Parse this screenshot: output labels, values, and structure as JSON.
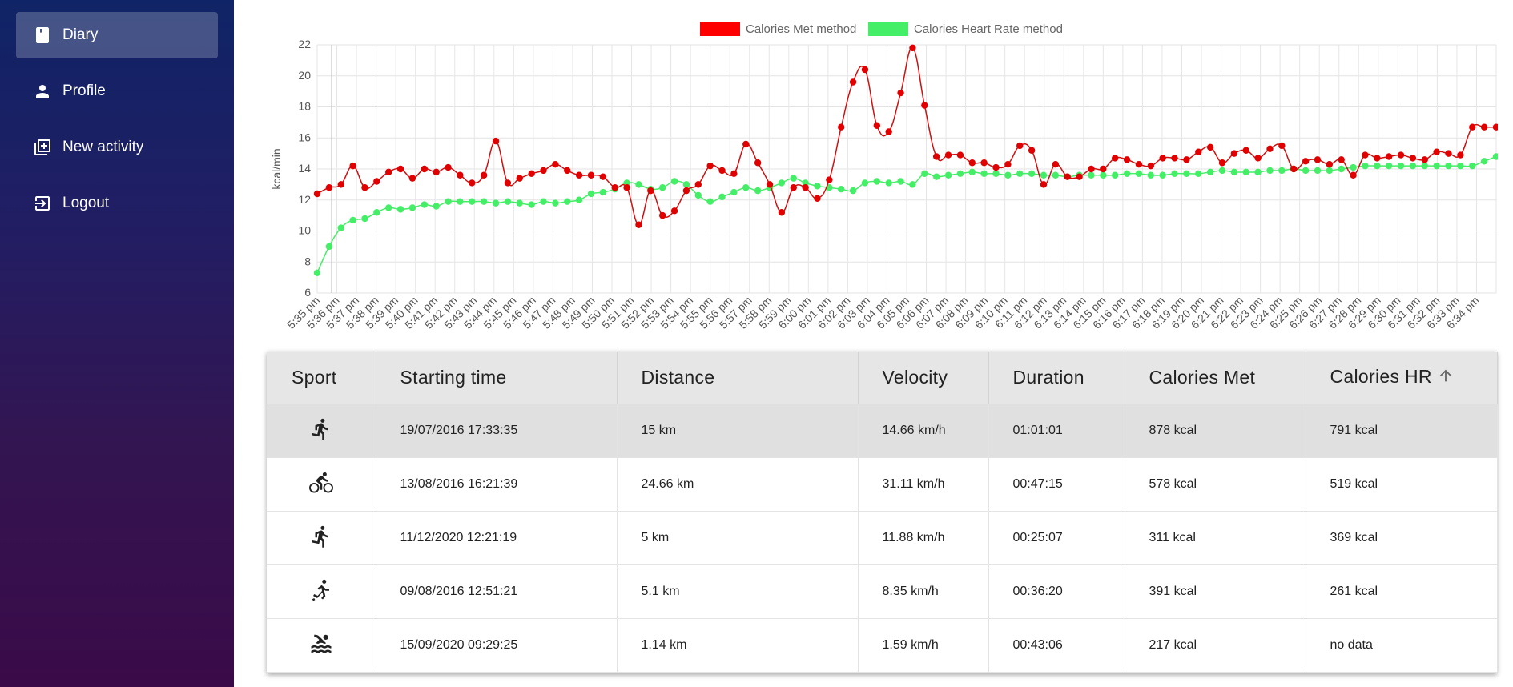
{
  "sidebar": {
    "items": [
      {
        "label": "Diary",
        "icon": "book-icon",
        "active": true
      },
      {
        "label": "Profile",
        "icon": "person-icon",
        "active": false
      },
      {
        "label": "New activity",
        "icon": "add-box-icon",
        "active": false
      },
      {
        "label": "Logout",
        "icon": "logout-icon",
        "active": false
      }
    ]
  },
  "chart_data": {
    "type": "line",
    "ylabel": "kcal/min",
    "ylim": [
      6,
      22
    ],
    "yticks": [
      6,
      8,
      10,
      12,
      14,
      16,
      18,
      20,
      22
    ],
    "grid": true,
    "legend_position": "top",
    "x_labels": [
      "5:35 pm",
      "5:36 pm",
      "5:37 pm",
      "5:38 pm",
      "5:39 pm",
      "5:40 pm",
      "5:41 pm",
      "5:42 pm",
      "5:43 pm",
      "5:44 pm",
      "5:45 pm",
      "5:46 pm",
      "5:47 pm",
      "5:48 pm",
      "5:49 pm",
      "5:50 pm",
      "5:51 pm",
      "5:52 pm",
      "5:53 pm",
      "5:54 pm",
      "5:55 pm",
      "5:56 pm",
      "5:57 pm",
      "5:58 pm",
      "5:59 pm",
      "6:00 pm",
      "6:01 pm",
      "6:02 pm",
      "6:03 pm",
      "6:04 pm",
      "6:05 pm",
      "6:06 pm",
      "6:07 pm",
      "6:08 pm",
      "6:09 pm",
      "6:10 pm",
      "6:11 pm",
      "6:12 pm",
      "6:13 pm",
      "6:14 pm",
      "6:15 pm",
      "6:16 pm",
      "6:17 pm",
      "6:18 pm",
      "6:19 pm",
      "6:20 pm",
      "6:21 pm",
      "6:22 pm",
      "6:23 pm",
      "6:24 pm",
      "6:25 pm",
      "6:26 pm",
      "6:27 pm",
      "6:28 pm",
      "6:29 pm",
      "6:30 pm",
      "6:31 pm",
      "6:32 pm",
      "6:33 pm",
      "6:34 pm"
    ],
    "series": [
      {
        "name": "Calories Met method",
        "color": "#ff0000",
        "line_color": "#d01010",
        "values": [
          12.4,
          12.8,
          13.0,
          14.2,
          12.8,
          13.2,
          13.8,
          14.0,
          13.4,
          14.0,
          13.8,
          14.1,
          13.6,
          13.1,
          13.6,
          15.8,
          13.1,
          13.4,
          13.7,
          13.9,
          14.3,
          13.9,
          13.6,
          13.6,
          13.5,
          12.8,
          12.8,
          10.4,
          12.6,
          11.0,
          11.3,
          12.6,
          13.0,
          14.2,
          13.9,
          13.7,
          15.6,
          14.4,
          13.0,
          11.2,
          12.8,
          12.8,
          12.1,
          13.3,
          16.7,
          19.6,
          20.4,
          16.8,
          16.4,
          18.9,
          21.8,
          18.1,
          14.8,
          14.9,
          14.9,
          14.4,
          14.4,
          14.1,
          14.3,
          15.5,
          15.2,
          13.0,
          14.3,
          13.5,
          13.5,
          14.0,
          14.0,
          14.7,
          14.6,
          14.3,
          14.2,
          14.7,
          14.7,
          14.6,
          15.1,
          15.4,
          14.4,
          15.0,
          15.2,
          14.7,
          15.3,
          15.5,
          14.0,
          14.5,
          14.6,
          14.3,
          14.6,
          13.6,
          14.9,
          14.7,
          14.8,
          14.9,
          14.7,
          14.6,
          15.1,
          15.0,
          14.9,
          16.7,
          16.7,
          16.7
        ]
      },
      {
        "name": "Calories Heart Rate method",
        "color": "#44ee66",
        "line_color": "#44ee66",
        "values": [
          7.3,
          9.0,
          10.2,
          10.7,
          10.8,
          11.2,
          11.5,
          11.4,
          11.5,
          11.7,
          11.6,
          11.9,
          11.9,
          11.9,
          11.9,
          11.8,
          11.9,
          11.8,
          11.7,
          11.9,
          11.8,
          11.9,
          12.0,
          12.4,
          12.5,
          12.7,
          13.1,
          13.0,
          12.7,
          12.8,
          13.2,
          13.0,
          12.3,
          11.9,
          12.2,
          12.5,
          12.8,
          12.6,
          12.8,
          13.1,
          13.4,
          13.1,
          12.9,
          12.8,
          12.7,
          12.6,
          13.1,
          13.2,
          13.1,
          13.2,
          13.0,
          13.7,
          13.5,
          13.6,
          13.7,
          13.8,
          13.7,
          13.7,
          13.6,
          13.7,
          13.7,
          13.6,
          13.6,
          13.5,
          13.6,
          13.6,
          13.6,
          13.6,
          13.7,
          13.7,
          13.6,
          13.6,
          13.7,
          13.7,
          13.7,
          13.8,
          13.9,
          13.8,
          13.8,
          13.8,
          13.9,
          13.9,
          14.0,
          13.9,
          13.9,
          13.9,
          14.0,
          14.1,
          14.2,
          14.2,
          14.2,
          14.2,
          14.2,
          14.2,
          14.2,
          14.2,
          14.2,
          14.2,
          14.5,
          14.8
        ]
      }
    ]
  },
  "table": {
    "columns": [
      "Sport",
      "Starting time",
      "Distance",
      "Velocity",
      "Duration",
      "Calories Met",
      "Calories HR"
    ],
    "sorted_column": "Calories HR",
    "rows": [
      {
        "sport_icon": "running-icon",
        "start": "19/07/2016 17:33:35",
        "distance": "15 km",
        "velocity": "14.66 km/h",
        "duration": "01:01:01",
        "cal_met": "878 kcal",
        "cal_hr": "791 kcal",
        "selected": true
      },
      {
        "sport_icon": "cycling-icon",
        "start": "13/08/2016 16:21:39",
        "distance": "24.66 km",
        "velocity": "31.11 km/h",
        "duration": "00:47:15",
        "cal_met": "578 kcal",
        "cal_hr": "519 kcal",
        "selected": false
      },
      {
        "sport_icon": "running-icon",
        "start": "11/12/2020 12:21:19",
        "distance": "5 km",
        "velocity": "11.88 km/h",
        "duration": "00:25:07",
        "cal_met": "311 kcal",
        "cal_hr": "369 kcal",
        "selected": false
      },
      {
        "sport_icon": "skating-icon",
        "start": "09/08/2016 12:51:21",
        "distance": "5.1 km",
        "velocity": "8.35 km/h",
        "duration": "00:36:20",
        "cal_met": "391 kcal",
        "cal_hr": "261 kcal",
        "selected": false
      },
      {
        "sport_icon": "swimming-icon",
        "start": "15/09/2020 09:29:25",
        "distance": "1.14 km",
        "velocity": "1.59 km/h",
        "duration": "00:43:06",
        "cal_met": "217 kcal",
        "cal_hr": "no data",
        "selected": false
      }
    ]
  }
}
